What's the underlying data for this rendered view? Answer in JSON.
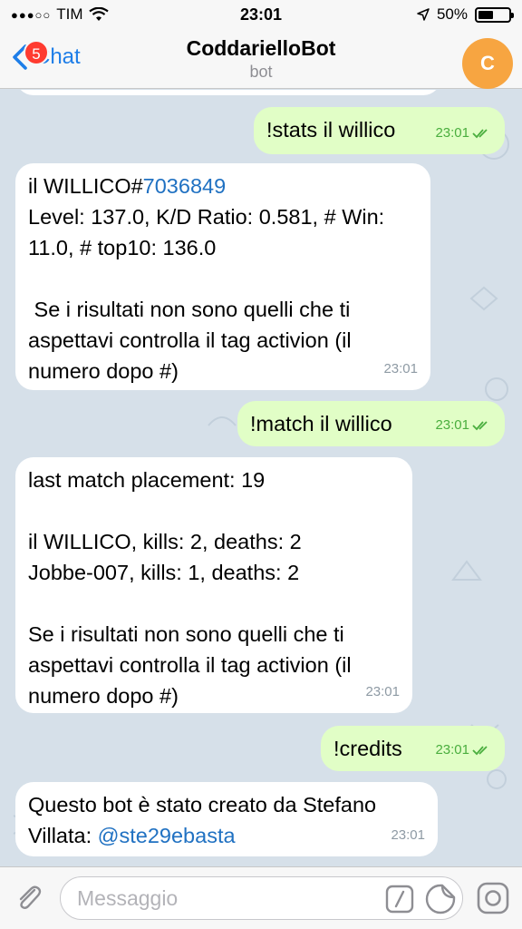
{
  "status_bar": {
    "carrier": "TIM",
    "time": "23:01",
    "battery": "50%",
    "battery_level": 0.5
  },
  "nav": {
    "back_label": "Chat",
    "unread_badge": "5",
    "title": "CoddarielloBot",
    "subtitle": "bot",
    "avatar_letter": "C",
    "avatar_color": "#f7a541"
  },
  "messages": [
    {
      "direction": "out",
      "text": "!stats il willico",
      "time": "23:01"
    },
    {
      "direction": "in",
      "parts": [
        "il WILLICO#",
        "7036849",
        "\nLevel: 137.0, K/D Ratio: 0.581, # Win:\n11.0, # top10: 136.0\n\n Se i risultati non sono quelli che ti\naspettavi controlla il tag activion (il\nnumero dopo #)"
      ],
      "time": "23:01"
    },
    {
      "direction": "out",
      "text": "!match il willico",
      "time": "23:01"
    },
    {
      "direction": "in",
      "text": "last match placement: 19\n\nil WILLICO, kills: 2, deaths: 2\nJobbe-007, kills: 1, deaths: 2\n\nSe i risultati non sono quelli che ti\naspettavi controlla il tag activion (il\nnumero dopo #)",
      "time": "23:01"
    },
    {
      "direction": "out",
      "text": "!credits",
      "time": "23:01"
    },
    {
      "direction": "in",
      "parts": [
        "Questo bot è stato creato da Stefano\nVillata: ",
        "@ste29ebasta"
      ],
      "time": "23:01"
    }
  ],
  "input": {
    "placeholder": "Messaggio"
  },
  "colors": {
    "accent": "#1e7ee8",
    "outgoing_bubble": "#e1fec6",
    "incoming_bubble": "#ffffff",
    "link": "#2071c2",
    "outgoing_time": "#4aae3e"
  }
}
